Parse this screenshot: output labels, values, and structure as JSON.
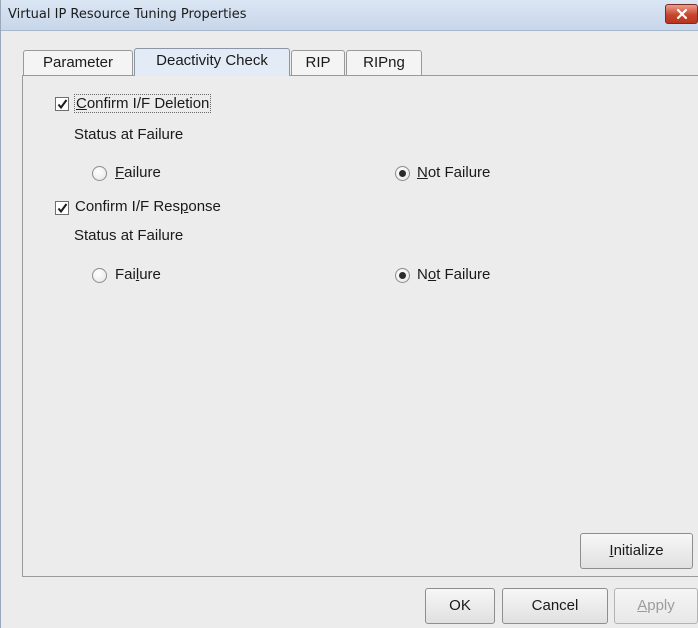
{
  "window": {
    "title": "Virtual IP Resource Tuning Properties",
    "close_icon": "close-icon"
  },
  "tabs": [
    {
      "label": "Parameter",
      "active": false
    },
    {
      "label": "Deactivity Check",
      "active": true
    },
    {
      "label": "RIP",
      "active": false
    },
    {
      "label": "RIPng",
      "active": false
    }
  ],
  "deletion": {
    "checkbox_pre": "",
    "checkbox_mn": "C",
    "checkbox_post": "onfirm I/F Deletion",
    "checked": true,
    "status_label": "Status at Failure",
    "failure_pre": "",
    "failure_mn": "F",
    "failure_post": "ailure",
    "not_failure_pre": "",
    "not_failure_mn": "N",
    "not_failure_post": "ot Failure",
    "selected": "Not Failure"
  },
  "response": {
    "checkbox_pre": "Confirm I/F Res",
    "checkbox_mn": "p",
    "checkbox_post": "onse",
    "checked": true,
    "status_label": "Status at Failure",
    "failure_pre": "Fai",
    "failure_mn": "l",
    "failure_post": "ure",
    "not_failure_pre": "N",
    "not_failure_mn": "o",
    "not_failure_post": "t Failure",
    "selected": "Not Failure"
  },
  "buttons": {
    "initialize_mn": "I",
    "initialize_post": "nitialize",
    "ok": "OK",
    "cancel": "Cancel",
    "apply_mn": "A",
    "apply_post": "pply",
    "apply_enabled": false
  }
}
